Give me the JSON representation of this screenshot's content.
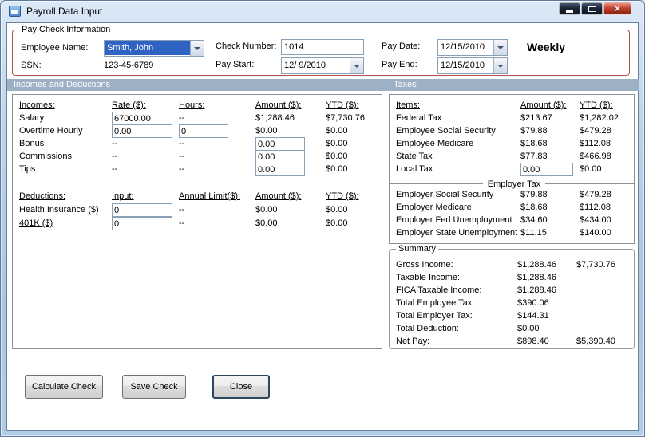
{
  "window": {
    "title": "Payroll Data Input"
  },
  "icons": {
    "close": "×"
  },
  "paycheck": {
    "legend": "Pay Check Information",
    "employee_name": {
      "label": "Employee Name:",
      "value": "Smith, John"
    },
    "ssn": {
      "label": "SSN:",
      "value": "123-45-6789"
    },
    "check_number": {
      "label": "Check Number:",
      "value": "1014"
    },
    "pay_start": {
      "label": "Pay Start:",
      "value": "12/ 9/2010"
    },
    "pay_date": {
      "label": "Pay Date:",
      "value": "12/15/2010"
    },
    "pay_end": {
      "label": "Pay End:",
      "value": "12/15/2010"
    },
    "frequency": "Weekly"
  },
  "section_headers": {
    "left": "Incomes and Deductions",
    "right": "Taxes"
  },
  "incomes": {
    "headers": {
      "label": "Incomes:",
      "rate": "Rate ($):",
      "hours": "Hours:",
      "amount": "Amount ($):",
      "ytd": "YTD ($):"
    },
    "salary": {
      "label": "Salary",
      "rate": "67000.00",
      "hours": "--",
      "amount": "$1,288.46",
      "ytd": "$7,730.76"
    },
    "overtime": {
      "label": "Overtime Hourly",
      "rate": "0.00",
      "hours": "0",
      "amount": "$0.00",
      "ytd": "$0.00"
    },
    "bonus": {
      "label": "Bonus",
      "rate": "--",
      "hours": "--",
      "amount": "0.00",
      "ytd": "$0.00"
    },
    "commissions": {
      "label": "Commissions",
      "rate": "--",
      "hours": "--",
      "amount": "0.00",
      "ytd": "$0.00"
    },
    "tips": {
      "label": "Tips",
      "rate": "--",
      "hours": "--",
      "amount": "0.00",
      "ytd": "$0.00"
    }
  },
  "deductions": {
    "headers": {
      "label": "Deductions:",
      "input": "Input:",
      "limit": "Annual Limit($):",
      "amount": "Amount ($):",
      "ytd": "YTD ($):"
    },
    "health": {
      "label": "Health Insurance  ($)",
      "input": "0",
      "limit": "--",
      "amount": "$0.00",
      "ytd": "$0.00"
    },
    "k401": {
      "label": "401K  ($)",
      "input": "0",
      "limit": "--",
      "amount": "$0.00",
      "ytd": "$0.00"
    }
  },
  "taxes": {
    "headers": {
      "items": "Items:",
      "amount": "Amount ($):",
      "ytd": "YTD ($):"
    },
    "federal": {
      "label": "Federal Tax",
      "amount": "$213.67",
      "ytd": "$1,282.02"
    },
    "employee_social_security": {
      "label": "Employee Social Security",
      "amount": "$79.88",
      "ytd": "$479.28"
    },
    "employee_medicare": {
      "label": "Employee Medicare",
      "amount": "$18.68",
      "ytd": "$112.08"
    },
    "state": {
      "label": "State Tax",
      "amount": "$77.83",
      "ytd": "$466.98"
    },
    "local": {
      "label": "Local Tax",
      "amount": "0.00",
      "ytd": "$0.00"
    },
    "employer_header": "Employer Tax",
    "employer_social_security": {
      "label": "Employer Social Security",
      "amount": "$79.88",
      "ytd": "$479.28"
    },
    "employer_medicare": {
      "label": "Employer Medicare",
      "amount": "$18.68",
      "ytd": "$112.08"
    },
    "employer_fed_unemployment": {
      "label": "Employer Fed Unemployment",
      "amount": "$34.60",
      "ytd": "$434.00"
    },
    "employer_state_unemployment": {
      "label": "Employer State Unemployment",
      "amount": "$11.15",
      "ytd": "$140.00"
    }
  },
  "summary": {
    "legend": "Summary",
    "gross": {
      "label": "Gross Income:",
      "value": "$1,288.46",
      "ytd": "$7,730.76"
    },
    "taxable": {
      "label": "Taxable Income:",
      "value": "$1,288.46"
    },
    "fica": {
      "label": "FICA Taxable Income:",
      "value": "$1,288.46"
    },
    "total_employee_tax": {
      "label": "Total Employee Tax:",
      "value": "$390.06"
    },
    "total_employer_tax": {
      "label": "Total Employer Tax:",
      "value": "$144.31"
    },
    "total_deduction": {
      "label": "Total Deduction:",
      "value": "$0.00"
    },
    "net_pay": {
      "label": "Net Pay:",
      "value": "$898.40",
      "ytd": "$5,390.40"
    }
  },
  "buttons": {
    "calculate": "Calculate Check",
    "save": "Save Check",
    "close": "Close"
  }
}
